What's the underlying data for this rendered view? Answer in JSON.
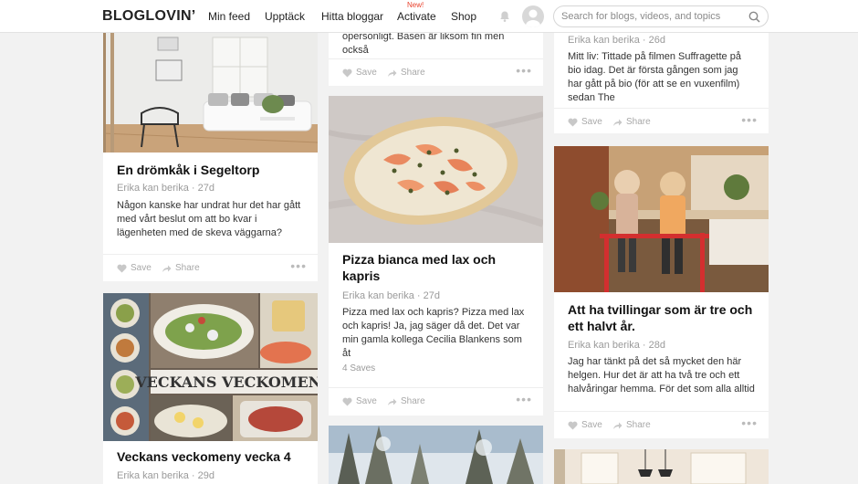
{
  "header": {
    "logo": "BLOGLOVIN’",
    "nav": [
      "Min feed",
      "Upptäck",
      "Hitta bloggar",
      "Activate",
      "Shop"
    ],
    "new_badge": "New!",
    "search_placeholder": "Search for blogs, videos, and topics"
  },
  "actions": {
    "save": "Save",
    "share": "Share",
    "more": "•••"
  },
  "cards": {
    "c1": {
      "title": "En drömkåk i Segeltorp",
      "meta": "Erika kan berika · 27d",
      "excerpt": "Någon kanske har undrat hur det har gått med vårt beslut om att bo kvar i lägenheten med de skeva väggarna?"
    },
    "c2": {
      "title": "Veckans veckomeny vecka 4",
      "meta": "Erika kan berika · 29d",
      "image_text": "VECKANS VECKOMENY"
    },
    "c3": {
      "excerpt": "opersonligt. Basen är liksom fin men också"
    },
    "c4": {
      "title": "Pizza bianca med lax och kapris",
      "meta": "Erika kan berika · 27d",
      "excerpt": "Pizza med lax och kapris? Pizza med lax och kapris! Ja, jag säger då det. Det var min gamla kollega Cecilia Blankens som åt",
      "saves": "4 Saves"
    },
    "c6": {
      "meta": "Erika kan berika · 26d",
      "excerpt": "Mitt liv: Tittade på filmen Suffragette på bio idag. Det är första gången som jag har gått på bio (för att se en vuxenfilm) sedan The"
    },
    "c7": {
      "title": "Att ha tvillingar som är tre och ett halvt år.",
      "meta": "Erika kan berika · 28d",
      "excerpt": "Jag har tänkt på det så mycket den här helgen. Hur det är att ha två tre och ett halvåringar hemma. För det som alla alltid"
    }
  }
}
